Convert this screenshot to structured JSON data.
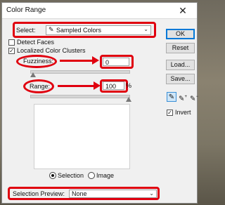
{
  "window": {
    "title": "Color Range",
    "close_glyph": "✕"
  },
  "select": {
    "label": "Select:",
    "icon": "eyedropper-icon",
    "value": "Sampled Colors"
  },
  "options": {
    "detect_faces": {
      "label": "Detect Faces",
      "checked": false
    },
    "localized_clusters": {
      "label": "Localized Color Clusters",
      "checked": true
    }
  },
  "fuzziness": {
    "label": "Fuzziness:",
    "value": "0",
    "level": 0
  },
  "range": {
    "label": "Range:",
    "value": "100",
    "unit": "%",
    "level": 100
  },
  "view": {
    "selection_label": "Selection",
    "image_label": "Image",
    "selected": "selection"
  },
  "preview": {
    "label": "Selection Preview:",
    "value": "None"
  },
  "buttons": {
    "ok": "OK",
    "reset": "Reset",
    "load": "Load...",
    "save": "Save..."
  },
  "eyedroppers": [
    "eyedropper-icon",
    "add-to-sample-icon",
    "subtract-from-sample-icon"
  ],
  "invert": {
    "label": "Invert",
    "checked": true
  },
  "colors": {
    "highlight_red": "#e0000f",
    "primary_button_border": "#0078d7"
  }
}
